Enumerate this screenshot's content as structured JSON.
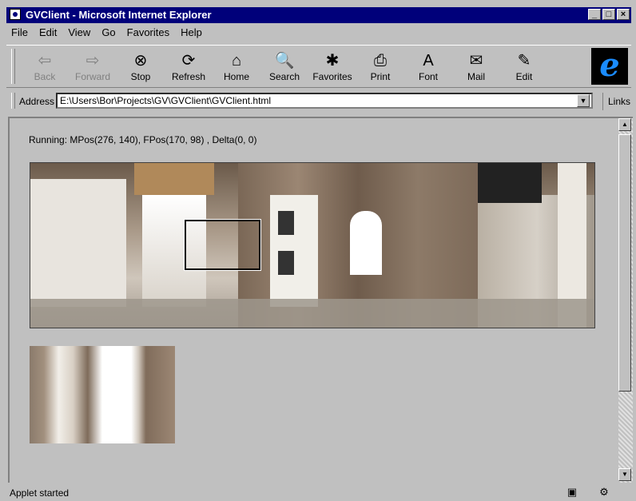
{
  "window": {
    "title": "GVClient - Microsoft Internet Explorer"
  },
  "menu": [
    "File",
    "Edit",
    "View",
    "Go",
    "Favorites",
    "Help"
  ],
  "toolbar": [
    {
      "label": "Back",
      "icon": "⇦",
      "disabled": true
    },
    {
      "label": "Forward",
      "icon": "⇨",
      "disabled": true
    },
    {
      "label": "Stop",
      "icon": "⊗"
    },
    {
      "label": "Refresh",
      "icon": "⟳"
    },
    {
      "label": "Home",
      "icon": "⌂"
    },
    {
      "label": "Search",
      "icon": "🔍"
    },
    {
      "label": "Favorites",
      "icon": "✱"
    },
    {
      "label": "Print",
      "icon": "⎙"
    },
    {
      "label": "Font",
      "icon": "A"
    },
    {
      "label": "Mail",
      "icon": "✉"
    },
    {
      "label": "Edit",
      "icon": "✎"
    }
  ],
  "address": {
    "label": "Address",
    "value": "E:\\Users\\Bor\\Projects\\GV\\GVClient\\GVClient.html"
  },
  "links_label": "Links",
  "content": {
    "status_line": "Running: MPos(276, 140),   FPos(170, 98) ,   Delta(0, 0)"
  },
  "statusbar": {
    "text": "Applet started"
  }
}
